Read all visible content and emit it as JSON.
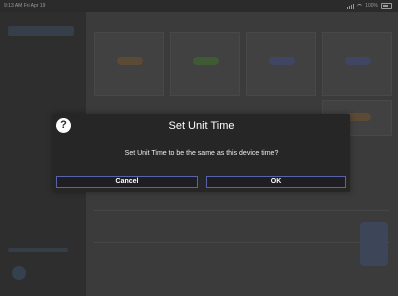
{
  "status_bar": {
    "time_date": "9:13 AM  Fri Apr 19",
    "battery": "100%"
  },
  "dialog": {
    "icon": "question-icon",
    "icon_glyph": "?",
    "title": "Set Unit Time",
    "message": "Set Unit Time to be the same as this device time?",
    "cancel_label": "Cancel",
    "ok_label": "OK"
  },
  "colors": {
    "overlay": "#3a3a3a",
    "dialog_bg": "#262626",
    "button_border": "#5b63a8",
    "tile_orange": "#5a4a36",
    "tile_green": "#3f5a34",
    "tile_blue": "#3f4663"
  }
}
